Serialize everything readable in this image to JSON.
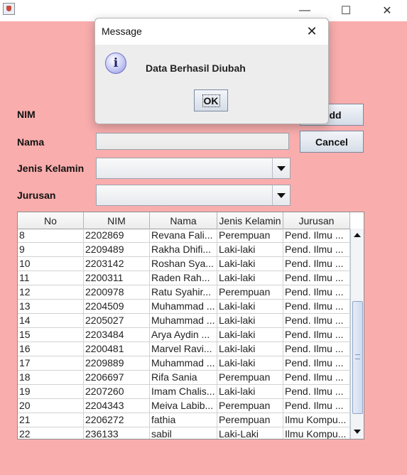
{
  "window": {
    "minimize_glyph": "—",
    "maximize_glyph": "☐",
    "close_glyph": "✕"
  },
  "form": {
    "nim_label": "NIM",
    "nama_label": "Nama",
    "jenis_kelamin_label": "Jenis Kelamin",
    "jurusan_label": "Jurusan",
    "nama_value": "",
    "jenis_kelamin_value": "",
    "jurusan_value": ""
  },
  "buttons": {
    "add_label": "Add",
    "cancel_label": "Cancel"
  },
  "table": {
    "headers": [
      "No",
      "NIM",
      "Nama",
      "Jenis Kelamin",
      "Jurusan"
    ],
    "rows": [
      [
        "8",
        "2202869",
        "Revana Fali...",
        "Perempuan",
        "Pend. Ilmu ..."
      ],
      [
        "9",
        "2209489",
        "Rakha Dhifi...",
        "Laki-laki",
        "Pend. Ilmu ..."
      ],
      [
        "10",
        "2203142",
        "Roshan Sya...",
        "Laki-laki",
        "Pend. Ilmu ..."
      ],
      [
        "11",
        "2200311",
        "Raden Rah...",
        "Laki-laki",
        "Pend. Ilmu ..."
      ],
      [
        "12",
        "2200978",
        "Ratu Syahir...",
        "Perempuan",
        "Pend. Ilmu ..."
      ],
      [
        "13",
        "2204509",
        "Muhammad ...",
        "Laki-laki",
        "Pend. Ilmu ..."
      ],
      [
        "14",
        "2205027",
        "Muhammad ...",
        "Laki-laki",
        "Pend. Ilmu ..."
      ],
      [
        "15",
        "2203484",
        "Arya Aydin ...",
        "Laki-laki",
        "Pend. Ilmu ..."
      ],
      [
        "16",
        "2200481",
        "Marvel Ravi...",
        "Laki-laki",
        "Pend. Ilmu ..."
      ],
      [
        "17",
        "2209889",
        "Muhammad ...",
        "Laki-laki",
        "Pend. Ilmu ..."
      ],
      [
        "18",
        "2206697",
        "Rifa Sania",
        "Perempuan",
        "Pend. Ilmu ..."
      ],
      [
        "19",
        "2207260",
        "Imam Chalis...",
        "Laki-laki",
        "Pend. Ilmu ..."
      ],
      [
        "20",
        "2204343",
        "Meiva Labib...",
        "Perempuan",
        "Pend. Ilmu ..."
      ],
      [
        "21",
        "2206272",
        "fathia",
        "Perempuan",
        "Ilmu Kompu..."
      ],
      [
        "22",
        "236133",
        "sabil",
        "Laki-Laki",
        "Ilmu Kompu..."
      ]
    ]
  },
  "dialog": {
    "title": "Message",
    "message": "Data Berhasil Diubah",
    "ok_label": "OK",
    "close_glyph": "✕",
    "icon_glyph": "i"
  },
  "colors": {
    "background": "#f9adad",
    "dialog_background": "#ededed"
  }
}
